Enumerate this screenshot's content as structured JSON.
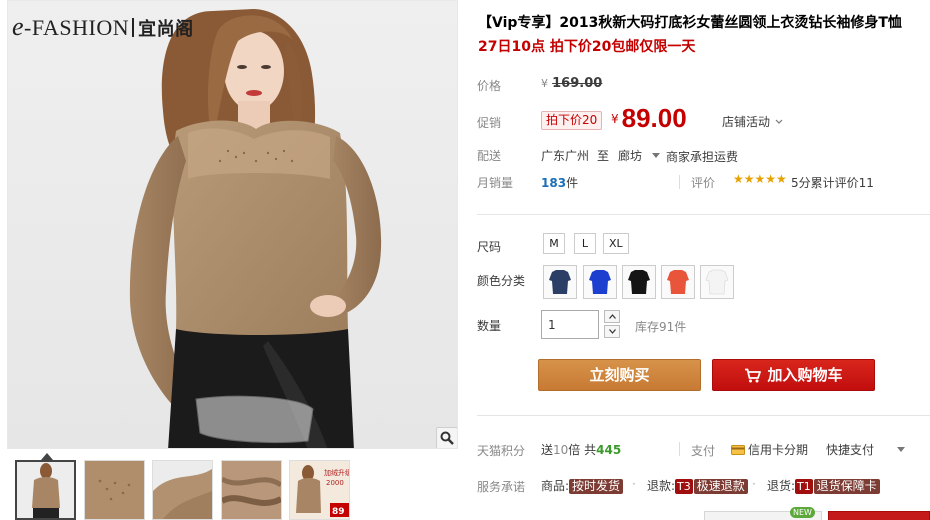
{
  "brand": {
    "logo_latin": "-FASHION",
    "logo_cn": "宜尚阁"
  },
  "product": {
    "title": "【Vip专享】2013秋新大码打底衫女蕾丝圆领上衣烫钻长袖修身T恤",
    "promo_line": "27日10点 拍下价20包邮仅限一天"
  },
  "price": {
    "label": "价格",
    "currency": "¥",
    "original": "169.00",
    "promo_label": "促销",
    "promo_tag": "拍下价20",
    "promo_price": "89.00",
    "shop_activity": "店铺活动"
  },
  "delivery": {
    "label": "配送",
    "from": "广东广州",
    "to_word": "至",
    "to": "廊坊",
    "freight": "商家承担运费"
  },
  "sales": {
    "label": "月销量",
    "count": "183",
    "unit": "件",
    "rating_label": "评价",
    "stars": "★★★★★",
    "rating_text": "5分累计评价11"
  },
  "sizes": {
    "label": "尺码",
    "options": [
      "M",
      "L",
      "XL"
    ]
  },
  "colors": {
    "label": "颜色分类",
    "swatches": [
      "#2a3e66",
      "#1d3fd0",
      "#151515",
      "#e8553a",
      "#f0f0f0"
    ]
  },
  "quantity": {
    "label": "数量",
    "value": "1",
    "stock": "库存91件"
  },
  "actions": {
    "buy_now": "立刻购买",
    "add_to_cart": "加入购物车"
  },
  "points": {
    "label": "天猫积分",
    "text_a": "送",
    "gift": "10",
    "text_b": "倍 共",
    "total": "445",
    "pay_label": "支付",
    "credit": "信用卡分期",
    "quick_pay": "快捷支付"
  },
  "service": {
    "label": "服务承诺",
    "goods_label": "商品:",
    "goods_badge": "按时发货",
    "refund_label": "退款:",
    "refund_code": "T3",
    "refund_badge": "极速退款",
    "return_label": "退货:",
    "return_code": "T1",
    "return_badge": "退货保障卡"
  },
  "misc": {
    "new_badge": "NEW"
  },
  "thumbnails": {
    "caption_1": "加绒升级",
    "caption_2": "2000",
    "price_tag": "89"
  },
  "colors_theme": {
    "accent_red": "#c40000",
    "buy_orange": "#d0873f",
    "cart_red": "#c91414"
  }
}
